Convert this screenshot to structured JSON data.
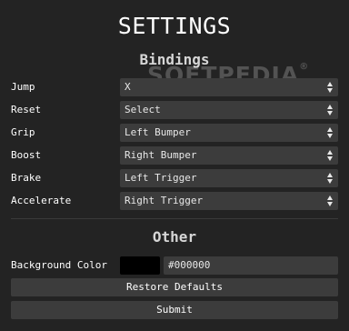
{
  "title": "SETTINGS",
  "watermark": "SOFTPEDIA",
  "bindings": {
    "heading": "Bindings",
    "rows": [
      {
        "label": "Jump",
        "value": "X"
      },
      {
        "label": "Reset",
        "value": "Select"
      },
      {
        "label": "Grip",
        "value": "Left Bumper"
      },
      {
        "label": "Boost",
        "value": "Right Bumper"
      },
      {
        "label": "Brake",
        "value": "Left Trigger"
      },
      {
        "label": "Accelerate",
        "value": "Right Trigger"
      }
    ]
  },
  "other": {
    "heading": "Other",
    "background_color_label": "Background Color",
    "background_color_value": "#000000"
  },
  "buttons": {
    "restore": "Restore Defaults",
    "submit": "Submit"
  },
  "colors": {
    "background": "#232323",
    "control": "#3c3c3c",
    "swatch": "#000000"
  }
}
